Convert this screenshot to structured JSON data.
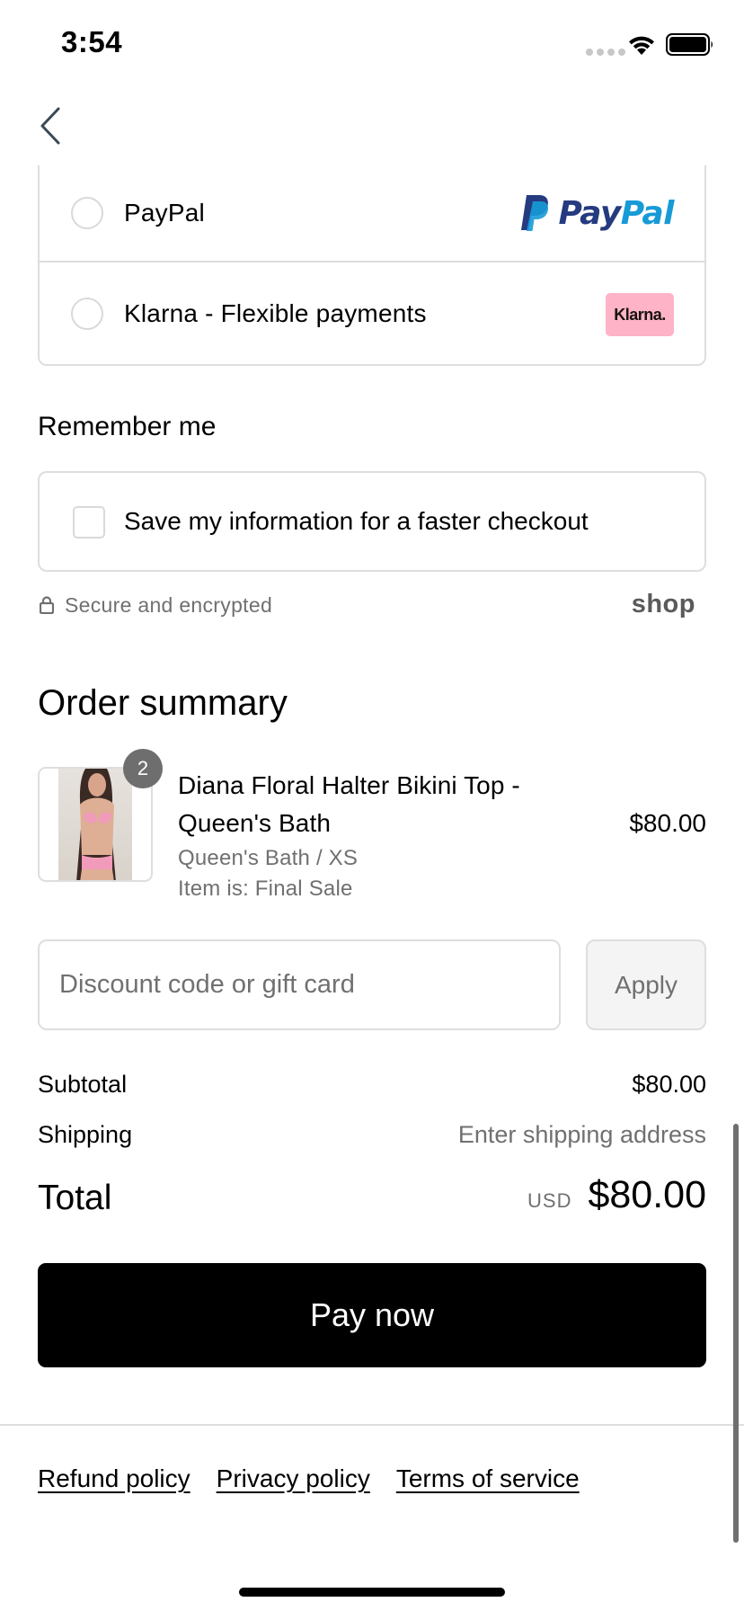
{
  "status_bar": {
    "time": "3:54"
  },
  "payment_options": [
    {
      "label": "PayPal",
      "logo_text_1": "Pay",
      "logo_text_2": "Pal"
    },
    {
      "label": "Klarna - Flexible payments",
      "logo_text": "Klarna."
    }
  ],
  "remember_me": {
    "title": "Remember me",
    "checkbox_label": "Save my information for a faster checkout",
    "checked": false
  },
  "secure": {
    "text": "Secure and encrypted",
    "brand": "shop"
  },
  "order_summary": {
    "title": "Order summary",
    "item": {
      "quantity": "2",
      "name": "Diana Floral Halter Bikini Top - Queen's Bath",
      "variant": "Queen's Bath / XS",
      "note": "Item is: Final Sale",
      "price": "$80.00"
    },
    "discount_placeholder": "Discount code or gift card",
    "apply_label": "Apply",
    "subtotal_label": "Subtotal",
    "subtotal_value": "$80.00",
    "shipping_label": "Shipping",
    "shipping_value": "Enter shipping address",
    "total_label": "Total",
    "currency": "USD",
    "total_value": "$80.00"
  },
  "pay_button": "Pay now",
  "footer": {
    "refund": "Refund policy",
    "privacy": "Privacy policy",
    "terms": "Terms of service"
  },
  "colors": {
    "accent": "#000000",
    "border": "#dedede",
    "muted_text": "#707070",
    "klarna_pink": "#ffb3c7",
    "paypal_dark": "#253b80",
    "paypal_light": "#179bd7"
  }
}
